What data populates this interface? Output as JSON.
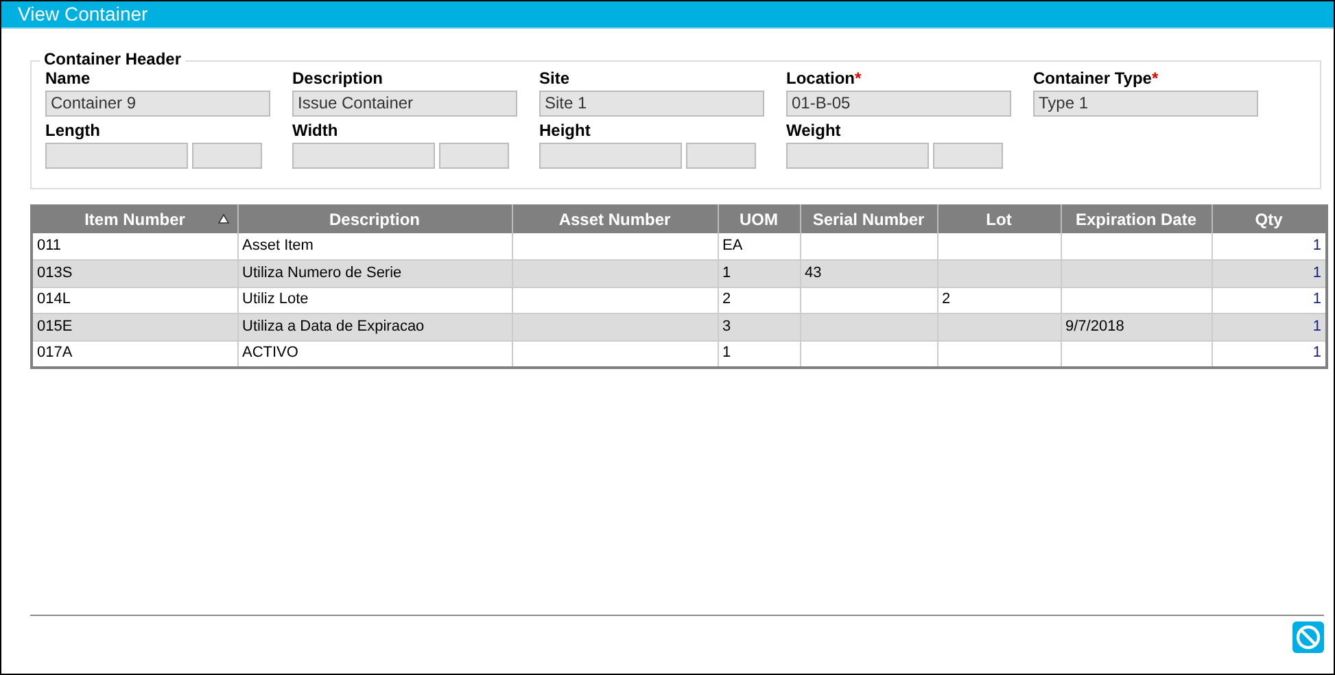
{
  "window": {
    "title": "View Container"
  },
  "header": {
    "legend": "Container Header",
    "fields": [
      {
        "kind": "text",
        "label": "Name",
        "value": "Container 9"
      },
      {
        "kind": "text",
        "label": "Description",
        "value": "Issue Container"
      },
      {
        "kind": "text",
        "label": "Site",
        "value": "Site 1"
      },
      {
        "kind": "text",
        "label": "Location",
        "required_mark": "*",
        "value": "01-B-05"
      },
      {
        "kind": "text",
        "label": "Container Type",
        "required_mark": "*",
        "value": "Type 1"
      },
      {
        "kind": "measure",
        "label": "Length"
      },
      {
        "kind": "measure",
        "label": "Width"
      },
      {
        "kind": "measure",
        "label": "Height"
      },
      {
        "kind": "measure",
        "label": "Weight"
      }
    ]
  },
  "table": {
    "columns": [
      {
        "label": "Item Number",
        "sorted_ascending": true
      },
      {
        "label": "Description"
      },
      {
        "label": "Asset Number"
      },
      {
        "label": "UOM"
      },
      {
        "label": "Serial Number"
      },
      {
        "label": "Lot"
      },
      {
        "label": "Expiration Date"
      },
      {
        "label": "Qty"
      }
    ],
    "rows": [
      [
        "011",
        "Asset Item",
        "",
        "EA",
        "",
        "",
        "",
        "1"
      ],
      [
        "013S",
        "Utiliza Numero de Serie",
        "",
        "1",
        "43",
        "",
        "",
        "1"
      ],
      [
        "014L",
        "Utiliz Lote",
        "",
        "2",
        "",
        "2",
        "",
        "1"
      ],
      [
        "015E",
        "Utiliza a Data de Expiracao",
        "",
        "3",
        "",
        "",
        "9/7/2018",
        "1"
      ],
      [
        "017A",
        "ACTIVO",
        "",
        "1",
        "",
        "",
        "",
        "1"
      ]
    ]
  },
  "footer": {
    "buttons": [
      {
        "kind": "cancel"
      }
    ]
  }
}
